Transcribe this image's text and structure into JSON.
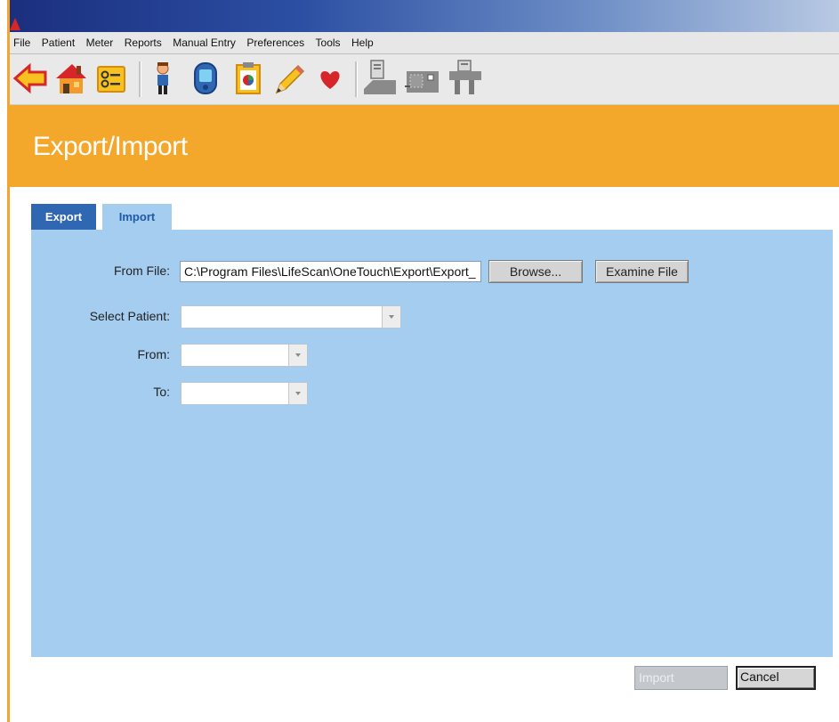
{
  "menu": [
    "File",
    "Patient",
    "Meter",
    "Reports",
    "Manual Entry",
    "Preferences",
    "Tools",
    "Help"
  ],
  "toolbar": {
    "icons": [
      "back-arrow-icon",
      "home-icon",
      "settings-list-icon",
      "patient-icon",
      "meter-icon",
      "clipboard-icon",
      "pencil-icon",
      "heart-icon",
      "download-device-icon",
      "network-device-icon",
      "upload-device-icon"
    ]
  },
  "page_title": "Export/Import",
  "tabs": [
    {
      "label": "Export",
      "active": false
    },
    {
      "label": "Import",
      "active": true
    }
  ],
  "form": {
    "from_file_label": "From File:",
    "from_file_value": "C:\\Program Files\\LifeScan\\OneTouch\\Export\\Export_",
    "browse_label": "Browse...",
    "examine_label": "Examine File",
    "select_patient_label": "Select Patient:",
    "select_patient_value": "",
    "from_label": "From:",
    "from_value": "",
    "to_label": "To:",
    "to_value": ""
  },
  "footer": {
    "import_label": "Import",
    "import_enabled": false,
    "cancel_label": "Cancel"
  },
  "colors": {
    "header_orange": "#f3a72b",
    "tab_active_blue": "#2f67b2",
    "panel_blue": "#a4cdf0"
  }
}
